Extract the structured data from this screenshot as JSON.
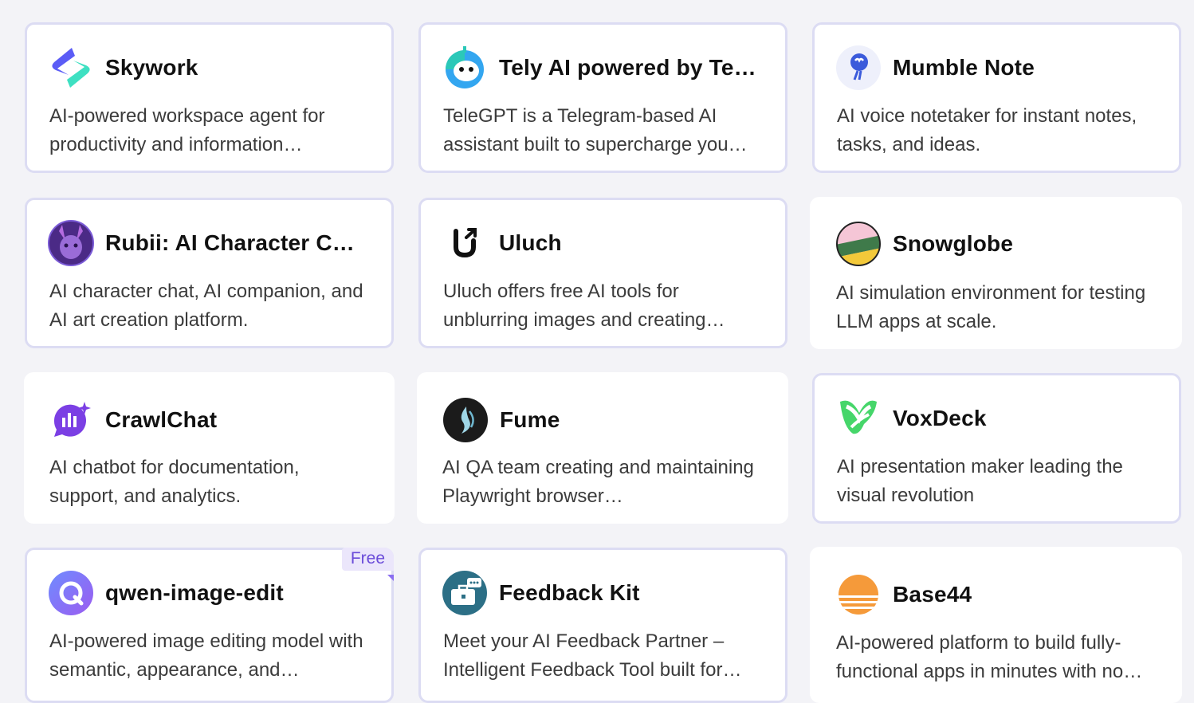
{
  "cards": [
    {
      "title": "Skywork",
      "desc": "AI-powered workspace agent for productivity and information…",
      "logo": "skywork-logo"
    },
    {
      "title": "Tely AI powered by Te…",
      "desc": "TeleGPT is a Telegram-based AI assistant built to supercharge you…",
      "logo": "tely-robot-logo"
    },
    {
      "title": "Mumble Note",
      "desc": "AI voice notetaker for instant notes, tasks, and ideas.",
      "logo": "mumble-note-logo"
    },
    {
      "title": "Rubii: AI Character C…",
      "desc": "AI character chat, AI companion, and AI art creation platform.",
      "logo": "rubii-avatar-logo"
    },
    {
      "title": "Uluch",
      "desc": "Uluch offers free AI tools for unblurring images and creating…",
      "logo": "uluch-logo"
    },
    {
      "title": "Snowglobe",
      "desc": "AI simulation environment for testing LLM apps at scale.",
      "logo": "snowglobe-logo"
    },
    {
      "title": "CrawlChat",
      "desc": "AI chatbot for documentation, support, and analytics.",
      "logo": "crawlchat-logo"
    },
    {
      "title": "Fume",
      "desc": "AI QA team creating and maintaining Playwright browser…",
      "logo": "fume-logo"
    },
    {
      "title": "VoxDeck",
      "desc": "AI presentation maker leading the visual revolution",
      "logo": "voxdeck-logo"
    },
    {
      "title": "qwen-image-edit",
      "desc": "AI-powered image editing model with semantic, appearance, and…",
      "logo": "qwen-logo",
      "badge": "Free"
    },
    {
      "title": "Feedback Kit",
      "desc": "Meet your AI Feedback Partner – Intelligent Feedback Tool built for…",
      "logo": "feedback-kit-logo"
    },
    {
      "title": "Base44",
      "desc": "AI-powered platform to build fully-functional apps in minutes with no…",
      "logo": "base44-logo"
    }
  ]
}
